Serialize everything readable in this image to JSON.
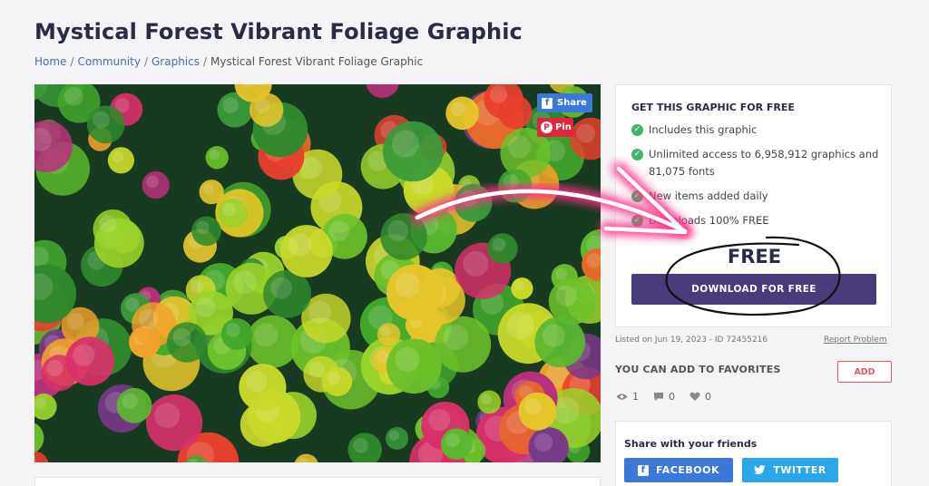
{
  "page": {
    "title": "Mystical Forest Vibrant Foliage Graphic"
  },
  "breadcrumb": {
    "home": "Home",
    "community": "Community",
    "graphics": "Graphics",
    "current": "Mystical Forest Vibrant Foliage Graphic",
    "separator": "/"
  },
  "image_actions": {
    "share_label": "Share",
    "pin_label": "Pin",
    "share_icon": "facebook-icon",
    "pin_icon": "pinterest-icon"
  },
  "offer": {
    "heading": "GET THIS GRAPHIC FOR FREE",
    "features": [
      "Includes this graphic",
      "Unlimited access to 6,958,912 graphics and 81,075 fonts",
      "New items added daily",
      "Downloads 100% FREE"
    ],
    "price_label": "FREE",
    "download_label": "DOWNLOAD FOR FREE",
    "accent": "#4a3b7c",
    "check_color": "#46b36a"
  },
  "meta": {
    "listed": "Listed on Jun 19, 2023 - ID 72455216",
    "report": "Report Problem"
  },
  "favorites": {
    "label": "YOU CAN ADD TO FAVORITES",
    "add_label": "ADD",
    "views": "1",
    "comments": "0",
    "likes": "0"
  },
  "share": {
    "heading": "Share with your friends",
    "facebook_label": "FACEBOOK",
    "twitter_label": "TWITTER",
    "facebook_color": "#3b78d8",
    "twitter_color": "#2ba6e8"
  },
  "annotation": {
    "arrow_color": "#ff2d8a",
    "circle_color": "#111111"
  }
}
